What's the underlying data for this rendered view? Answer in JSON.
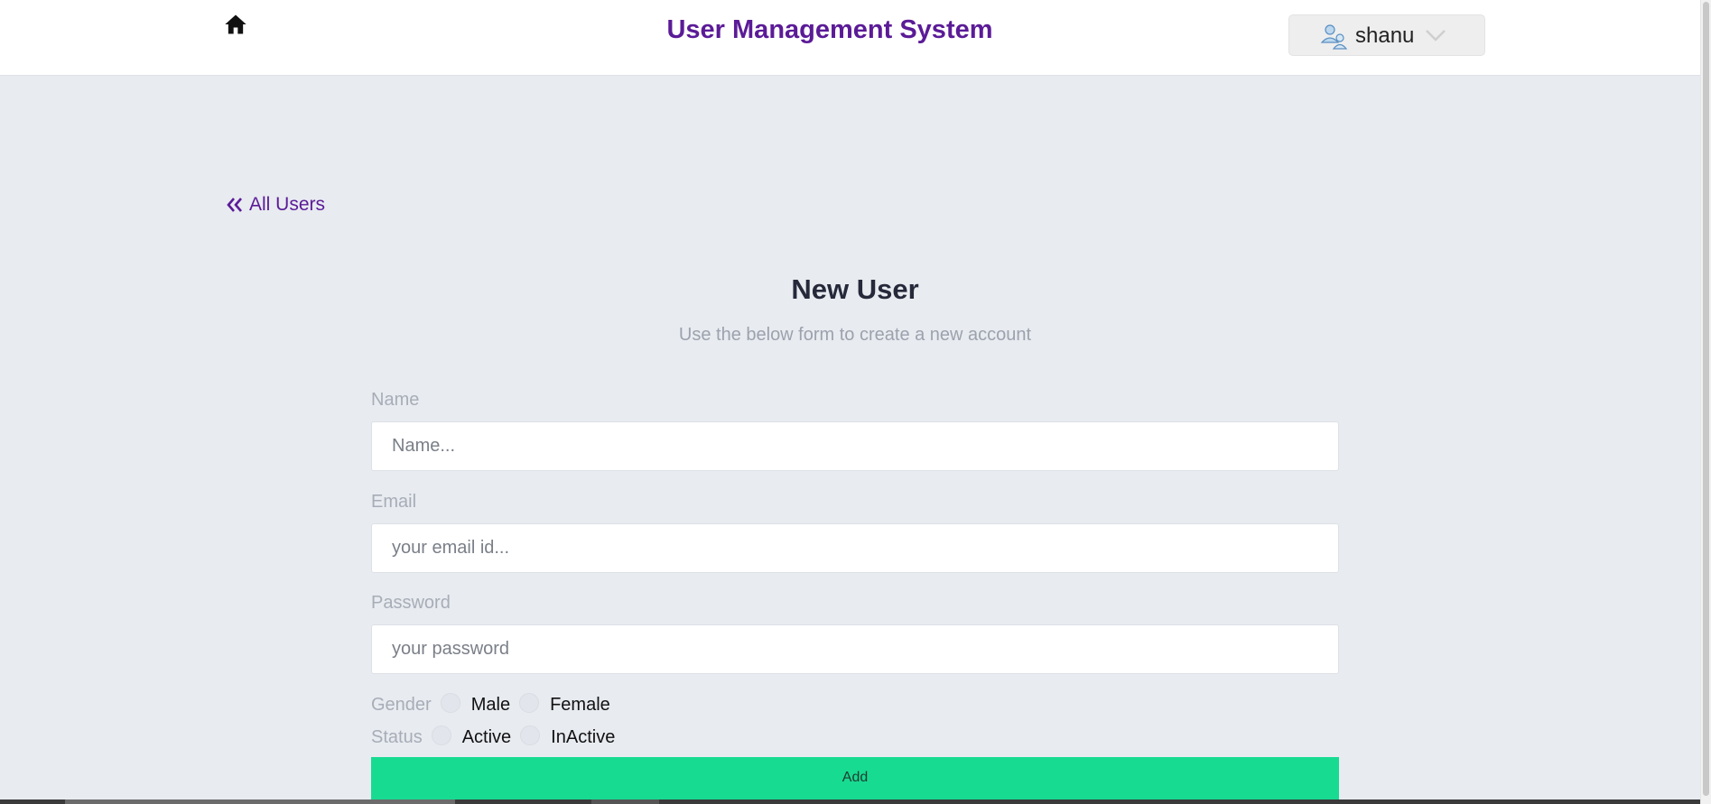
{
  "header": {
    "title": "User Management System",
    "user_name": "shanu",
    "icons": {
      "home": "home-icon",
      "avatar": "user-group-icon",
      "dropdown": "chevron-down-icon"
    }
  },
  "nav": {
    "back_label": "All Users",
    "back_icon": "double-chevron-left-icon"
  },
  "form": {
    "title": "New User",
    "subtitle": "Use the below form to create a new account",
    "name": {
      "label": "Name",
      "placeholder": "Name..."
    },
    "email": {
      "label": "Email",
      "placeholder": "your email id..."
    },
    "password": {
      "label": "Password",
      "placeholder": "your password"
    },
    "gender": {
      "label": "Gender",
      "options": [
        "Male",
        "Female"
      ]
    },
    "status": {
      "label": "Status",
      "options": [
        "Active",
        "InActive"
      ]
    },
    "submit_label": "Add"
  },
  "colors": {
    "brand": "#5b1b97",
    "background": "#e8ebf0",
    "submit": "#18db92"
  }
}
